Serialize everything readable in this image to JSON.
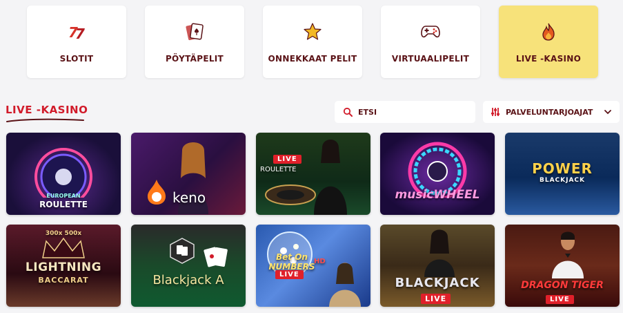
{
  "categories": [
    {
      "label": "SLOTIT",
      "icon": "slot-777-icon"
    },
    {
      "label": "PÖYTÄPELIT",
      "icon": "playing-cards-icon"
    },
    {
      "label": "ONNEKKAAT PELIT",
      "icon": "star-icon"
    },
    {
      "label": "VIRTUAALIPELIT",
      "icon": "gamepad-icon"
    },
    {
      "label": "LIVE -KASINO",
      "icon": "flame-icon",
      "active": true
    }
  ],
  "section": {
    "title": "LIVE -KASINO"
  },
  "search": {
    "placeholder": "ETSI"
  },
  "providers": {
    "label": "PALVELUNTARJOAJAT"
  },
  "games": [
    {
      "title": "ROULETTE",
      "subtitle": "EUROPEAN"
    },
    {
      "title": "keno"
    },
    {
      "title": "ROULETTE",
      "badge": "LIVE"
    },
    {
      "title": "musicWHEEL"
    },
    {
      "title": "POWER",
      "subtitle": "BLACKJACK"
    },
    {
      "title": "LIGHTNING",
      "subtitle": "BACCARAT",
      "extra": "300x  500x"
    },
    {
      "title": "Blackjack A"
    },
    {
      "title": "Bet On NUMBERS",
      "badge": "LIVE",
      "extra": "HD"
    },
    {
      "title": "BLACKJACK",
      "badge": "LIVE"
    },
    {
      "title": "DRAGON TIGER",
      "badge": "LIVE"
    }
  ],
  "colors": {
    "brand": "#5a1216",
    "accent": "#d11b2a",
    "active_bg": "#f7e27a"
  }
}
